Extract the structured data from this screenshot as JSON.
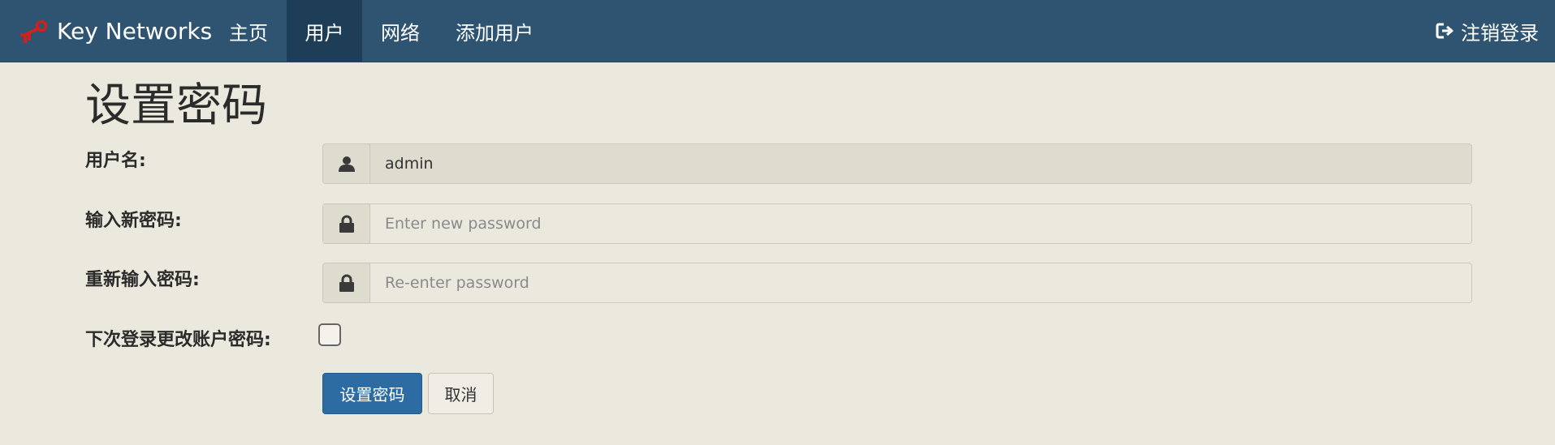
{
  "navbar": {
    "brand": "Key Networks",
    "items": [
      {
        "label": "主页",
        "active": false
      },
      {
        "label": "用户",
        "active": true
      },
      {
        "label": "网络",
        "active": false
      },
      {
        "label": "添加用户",
        "active": false
      }
    ],
    "logout_label": "注销登录"
  },
  "page": {
    "title": "设置密码"
  },
  "form": {
    "username": {
      "label": "用户名:",
      "value": "admin",
      "icon": "user-icon"
    },
    "new_password": {
      "label": "输入新密码:",
      "placeholder": "Enter new password",
      "icon": "lock-icon"
    },
    "confirm_password": {
      "label": "重新输入密码:",
      "placeholder": "Re-enter password",
      "icon": "lock-icon"
    },
    "change_next_login": {
      "label": "下次登录更改账户密码:",
      "checked": false
    },
    "submit_label": "设置密码",
    "cancel_label": "取消"
  },
  "colors": {
    "navbar": "#2f5472",
    "navbar_active": "#1e3e57",
    "background": "#ebe9dd",
    "primary_button": "#2d6ca2",
    "logo_red": "#d0211c"
  }
}
